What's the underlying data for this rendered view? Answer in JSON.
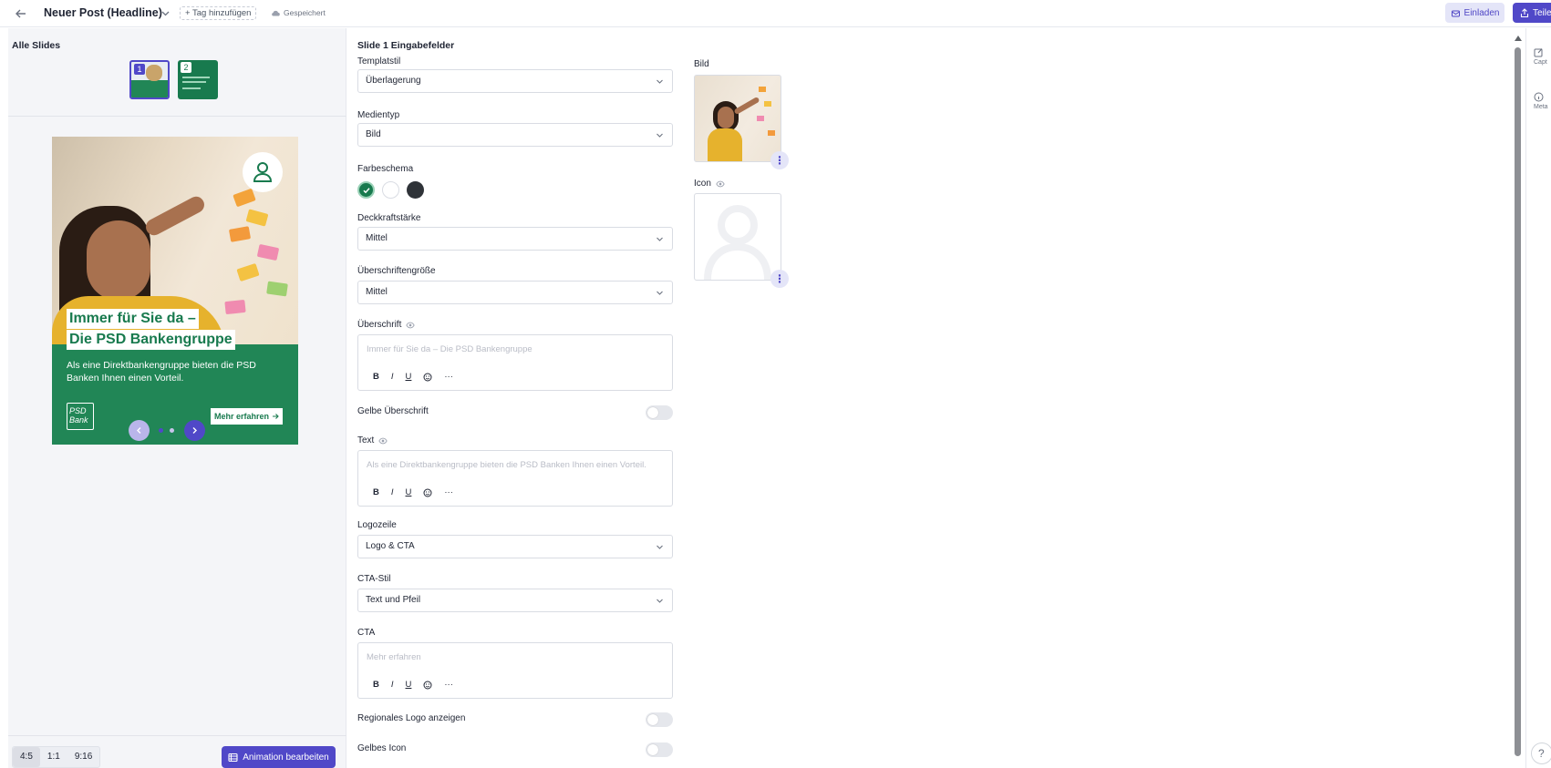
{
  "header": {
    "title": "Neuer Post (Headline)",
    "tag_button": "+ Tag hinzufügen",
    "saved_status": "Gespeichert",
    "invite_label": "Einladen",
    "share_label": "Teilen"
  },
  "left_panel": {
    "all_slides_label": "Alle Slides",
    "thumbnails": [
      {
        "number": "1"
      },
      {
        "number": "2"
      }
    ],
    "preview": {
      "headline_line1": "Immer für Sie da –",
      "headline_line2": "Die PSD Bankengruppe",
      "body": "Als eine Direktbankengruppe bieten die PSD Banken Ihnen einen Vorteil.",
      "logo_text_line1": "PSD",
      "logo_text_line2": "Bank",
      "cta": "Mehr erfahren",
      "colors": {
        "green": "#218656",
        "brand_green": "#187a4e"
      }
    },
    "aspect_ratios": [
      "4:5",
      "1:1",
      "9:16"
    ],
    "active_ratio": "4:5",
    "animation_button": "Animation bearbeiten"
  },
  "form": {
    "title": "Slide 1 Eingabefelder",
    "template_style": {
      "label": "Templatstil",
      "value": "Überlagerung"
    },
    "media_type": {
      "label": "Medientyp",
      "value": "Bild"
    },
    "color_scheme": {
      "label": "Farbeschema",
      "options": [
        "#187a4e",
        "#ffffff",
        "#2f3338"
      ],
      "selected": "#187a4e"
    },
    "opacity": {
      "label": "Deckkraftstärke",
      "value": "Mittel"
    },
    "headline_size": {
      "label": "Überschriftengröße",
      "value": "Mittel"
    },
    "headline": {
      "label": "Überschrift",
      "placeholder": "Immer für Sie da – Die PSD Bankengruppe"
    },
    "yellow_headline": {
      "label": "Gelbe Überschrift",
      "on": false
    },
    "text": {
      "label": "Text",
      "placeholder": "Als eine Direktbankengruppe bieten die PSD Banken Ihnen einen Vorteil."
    },
    "logo_row": {
      "label": "Logozeile",
      "value": "Logo & CTA"
    },
    "cta_style": {
      "label": "CTA-Stil",
      "value": "Text und Pfeil"
    },
    "cta": {
      "label": "CTA",
      "placeholder": "Mehr erfahren"
    },
    "regional_logo": {
      "label": "Regionales Logo anzeigen",
      "on": false
    },
    "yellow_icon": {
      "label": "Gelbes Icon",
      "on": false
    },
    "rte_tools": {
      "bold": "B",
      "italic": "I",
      "underline": "U",
      "more": "···"
    }
  },
  "media": {
    "image_label": "Bild",
    "icon_label": "Icon"
  },
  "right_rail": {
    "items": [
      "Capt",
      "Meta"
    ],
    "help": "?"
  }
}
